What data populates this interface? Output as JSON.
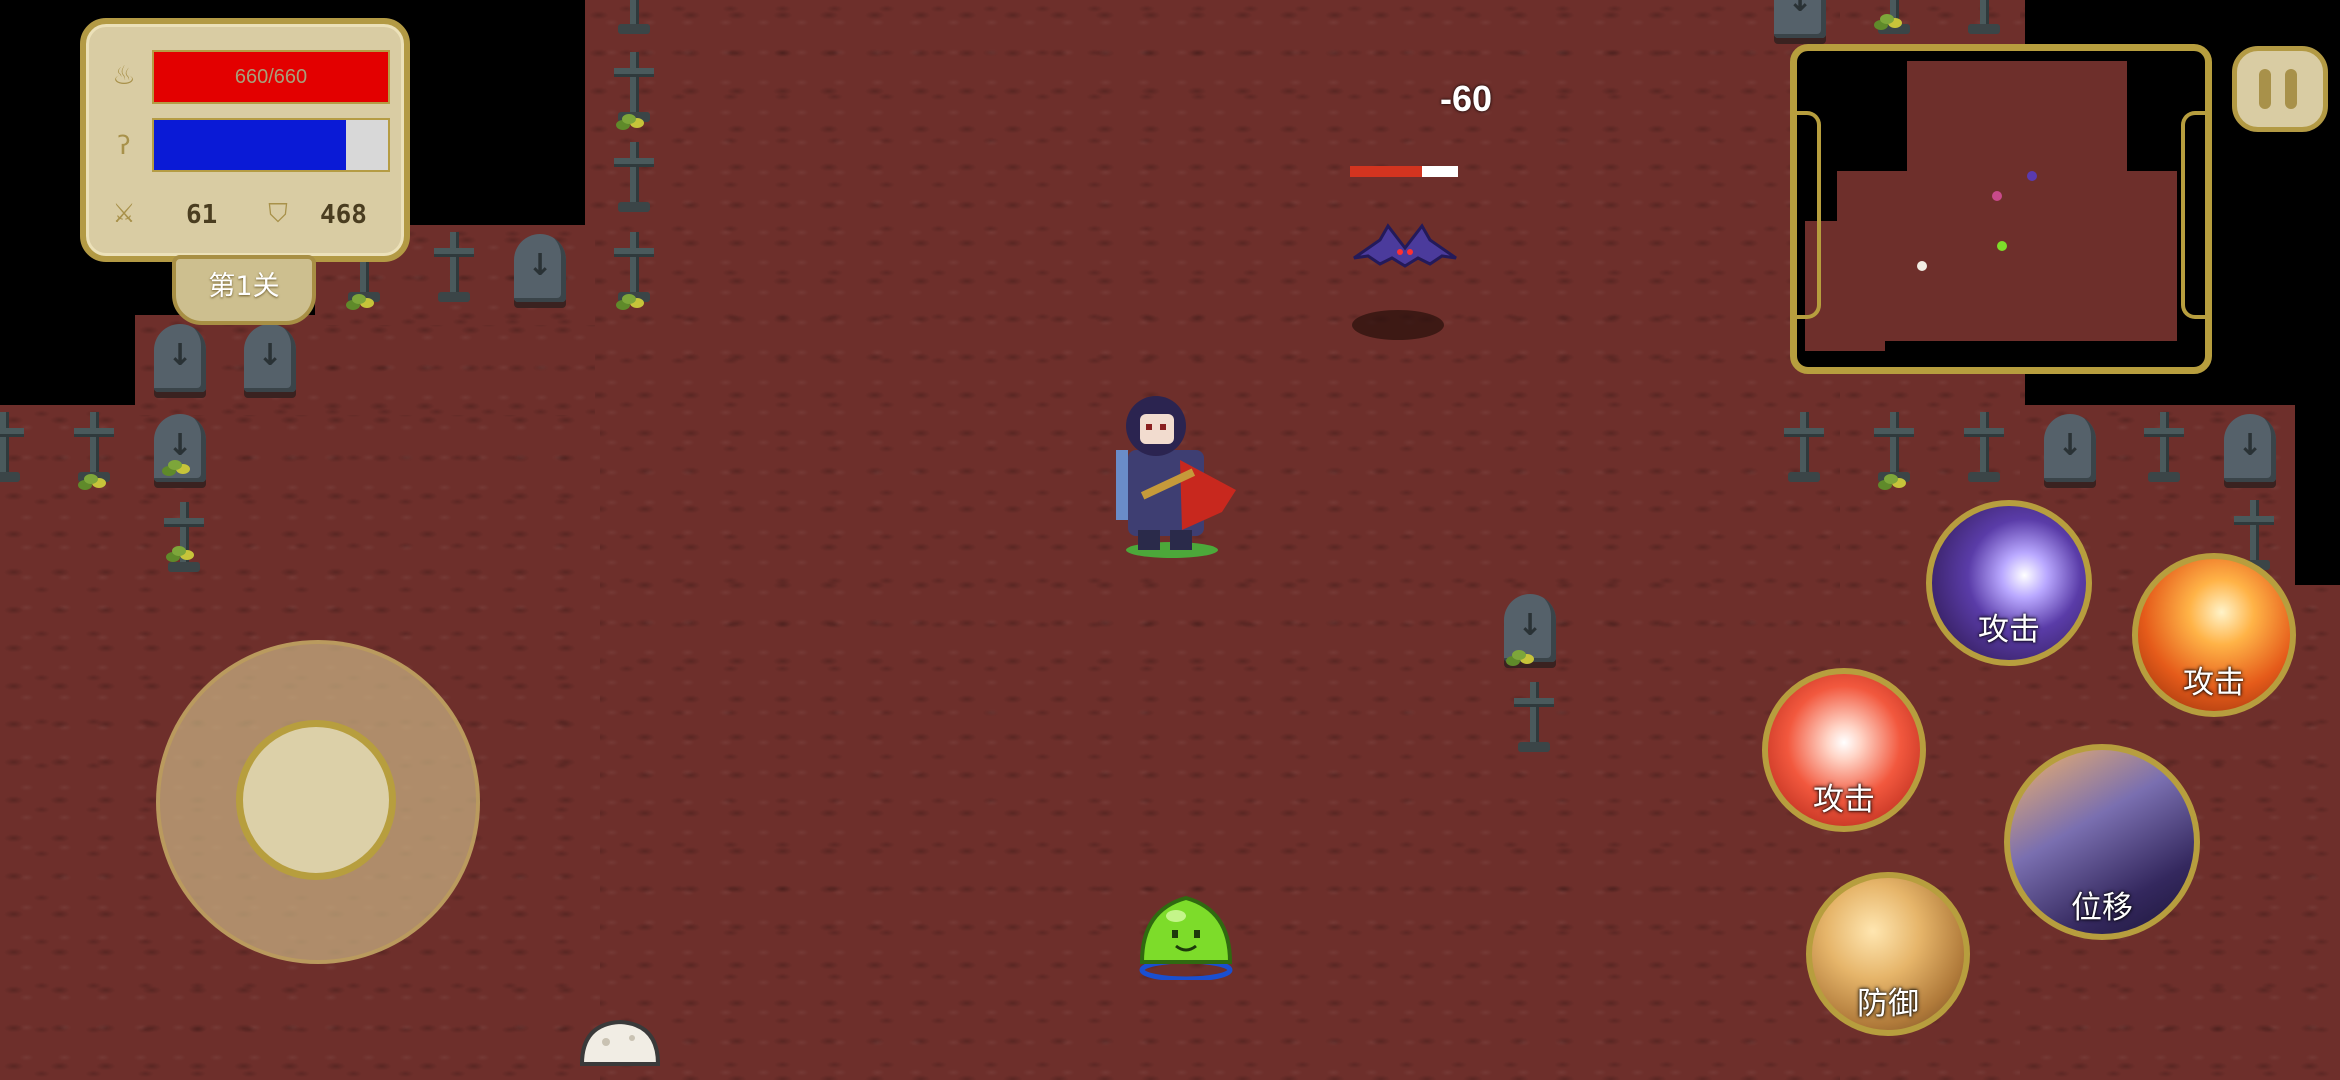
{
  "hud": {
    "hp_text": "660/660",
    "hp_ratio": 1.0,
    "mp_ratio": 0.82,
    "hp_icon": "flame-icon",
    "mp_icon": "swirl-icon",
    "attack_icon": "sword-icon",
    "defense_icon": "shield-icon",
    "attack_value": "61",
    "defense_value": "468",
    "level_label": "第1关",
    "colors": {
      "hp": "#e30000",
      "mp": "#0a1ad6",
      "gold": "#b39a44"
    }
  },
  "combat": {
    "damage_text": "-60",
    "enemy_hp_ratio": 0.67
  },
  "minimap": {
    "name": "minimap"
  },
  "pause": {
    "icon": "pause-icon"
  },
  "joystick": {
    "name": "virtual-joystick"
  },
  "skills": {
    "skill1_label": "攻击",
    "skill2_label": "攻击",
    "skill3_label": "攻击",
    "dash_label": "位移",
    "defend_label": "防御"
  }
}
